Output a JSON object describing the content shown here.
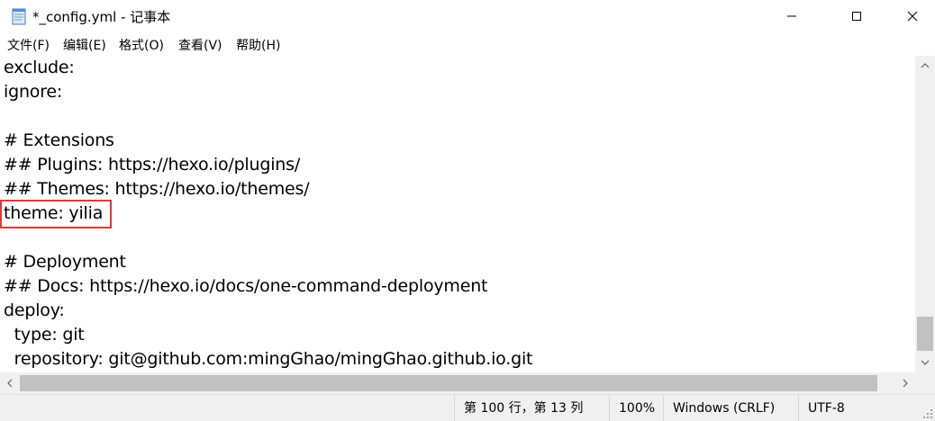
{
  "window": {
    "title": "*_config.yml - 记事本",
    "app_icon": "notepad-icon",
    "controls": {
      "minimize": "minimize-icon",
      "maximize": "maximize-icon",
      "close": "close-icon"
    }
  },
  "menu": [
    {
      "label": "文件(F)"
    },
    {
      "label": "编辑(E)"
    },
    {
      "label": "格式(O)"
    },
    {
      "label": "查看(V)"
    },
    {
      "label": "帮助(H)"
    }
  ],
  "editor": {
    "lines": [
      "exclude:",
      "ignore:",
      "",
      "# Extensions",
      "## Plugins: https://hexo.io/plugins/",
      "## Themes: https://hexo.io/themes/",
      "theme: yilia",
      "",
      "# Deployment",
      "## Docs: https://hexo.io/docs/one-command-deployment",
      "deploy:",
      "  type: git",
      "  repository: git@github.com:mingGhao/mingGhao.github.io.git"
    ],
    "highlight_color": "#e0393b"
  },
  "statusbar": {
    "position": "第 100 行，第 13 列",
    "zoom": "100%",
    "line_ending": "Windows (CRLF)",
    "encoding": "UTF-8"
  }
}
